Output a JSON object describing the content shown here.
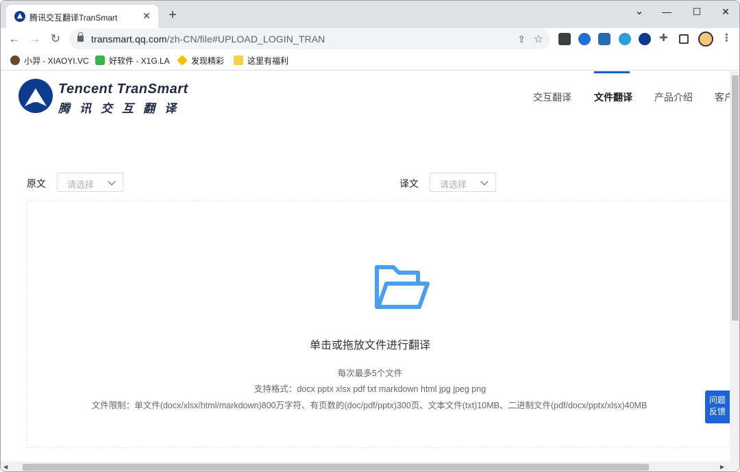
{
  "browser": {
    "tab_title": "腾讯交互翻译TranSmart",
    "tab_close": "✕",
    "new_tab": "+",
    "url_host": "transmart.qq.com",
    "url_path": "/zh-CN/file#UPLOAD_LOGIN_TRAN",
    "window_controls": {
      "minimize": "—",
      "maximize": "☐",
      "close": "✕",
      "tabsearch": "⌄"
    },
    "nav": {
      "back": "←",
      "forward": "→",
      "reload": "↻"
    }
  },
  "bookmarks": [
    {
      "label": "小羿 - XIAOYI.VC",
      "icon": "avatar-icon",
      "color": "#6b4a2a"
    },
    {
      "label": "好软件 - X1G.LA",
      "icon": "app-icon",
      "color": "#37b24d"
    },
    {
      "label": "发现精彩",
      "icon": "diamond-icon",
      "color": "#f2c200"
    },
    {
      "label": "这里有福利",
      "icon": "folder-icon",
      "color": "#f6d24a"
    }
  ],
  "site": {
    "logo_en": "Tencent TranSmart",
    "logo_cn": "腾讯交互翻译",
    "nav": [
      "交互翻译",
      "文件翻译",
      "产品介绍",
      "客户"
    ],
    "active_nav": "文件翻译"
  },
  "upload": {
    "source_label": "原文",
    "target_label": "译文",
    "source_placeholder": "请选择",
    "target_placeholder": "请选择",
    "title": "单击或拖放文件进行翻译",
    "limit_count": "每次最多5个文件",
    "formats": "支持格式：docx pptx xlsx pdf txt markdown html jpg jpeg png",
    "limits": "文件限制：单文件(docx/xlsx/html/markdown)800万字符、有页数的(doc/pdf/pptx)300页、文本文件(txt)10MB、二进制文件(pdf/docx/pptx/xlsx)40MB"
  },
  "feedback": {
    "line1": "问题",
    "line2": "反馈"
  },
  "colors": {
    "accent": "#1a5ad7",
    "folder": "#4a9ef0",
    "logo": "#0d3b8e"
  }
}
